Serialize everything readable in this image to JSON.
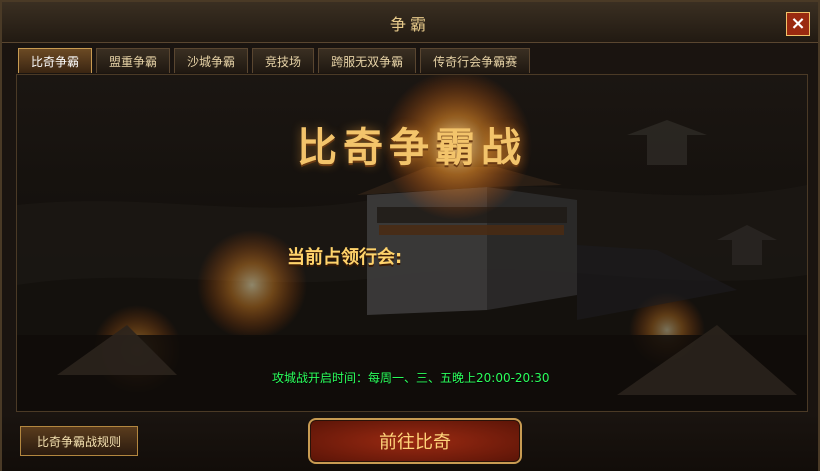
{
  "window": {
    "title": "争霸"
  },
  "tabs": [
    {
      "label": "比奇争霸"
    },
    {
      "label": "盟重争霸"
    },
    {
      "label": "沙城争霸"
    },
    {
      "label": "竞技场"
    },
    {
      "label": "跨服无双争霸"
    },
    {
      "label": "传奇行会争霸赛"
    }
  ],
  "scene": {
    "heading": "比奇争霸战",
    "occupant_label": "当前占领行会:",
    "schedule": "攻城战开启时间：每周一、三、五晚上20:00-20:30"
  },
  "bottom": {
    "rules_label": "比奇争霸战规则",
    "go_label": "前往比奇"
  },
  "colors": {
    "accent": "#f3c46b",
    "schedule": "#2bff5c",
    "close": "#9a2a10"
  },
  "icons": {
    "close": "close-icon"
  }
}
